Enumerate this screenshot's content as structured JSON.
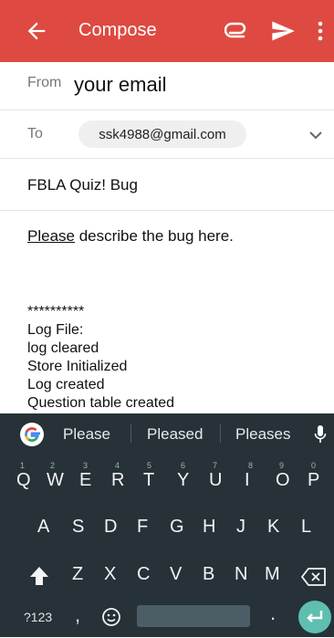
{
  "appbar": {
    "title": "Compose",
    "accent": "#de4a41",
    "icons": [
      "back-arrow-icon",
      "paperclip-icon",
      "send-icon",
      "more-vert-icon"
    ]
  },
  "from": {
    "label": "From",
    "value": "your email"
  },
  "to": {
    "label": "To",
    "recipient": "ssk4988@gmail.com",
    "icon": "chevron-down-icon"
  },
  "subject": "FBLA Quiz! Bug",
  "body": {
    "first_word": "Please",
    "rest": " describe the bug here.",
    "log_lines": [
      "**********",
      "Log File:",
      "log cleared",
      "Store Initialized",
      "Log created",
      "Question table created"
    ]
  },
  "keyboard": {
    "background": "#263238",
    "suggestions": [
      "Please",
      "Pleased",
      "Pleases"
    ],
    "row1": [
      {
        "key": "Q",
        "hint": "1"
      },
      {
        "key": "W",
        "hint": "2"
      },
      {
        "key": "E",
        "hint": "3"
      },
      {
        "key": "R",
        "hint": "4"
      },
      {
        "key": "T",
        "hint": "5"
      },
      {
        "key": "Y",
        "hint": "6"
      },
      {
        "key": "U",
        "hint": "7"
      },
      {
        "key": "I",
        "hint": "8"
      },
      {
        "key": "O",
        "hint": "9"
      },
      {
        "key": "P",
        "hint": "0"
      }
    ],
    "row2": [
      "A",
      "S",
      "D",
      "F",
      "G",
      "H",
      "J",
      "K",
      "L"
    ],
    "row3": [
      "Z",
      "X",
      "C",
      "V",
      "B",
      "N",
      "M"
    ],
    "symbols_key": "?123",
    "comma_key": ",",
    "period_key": ".",
    "enter_color": "#5ebfb0"
  }
}
